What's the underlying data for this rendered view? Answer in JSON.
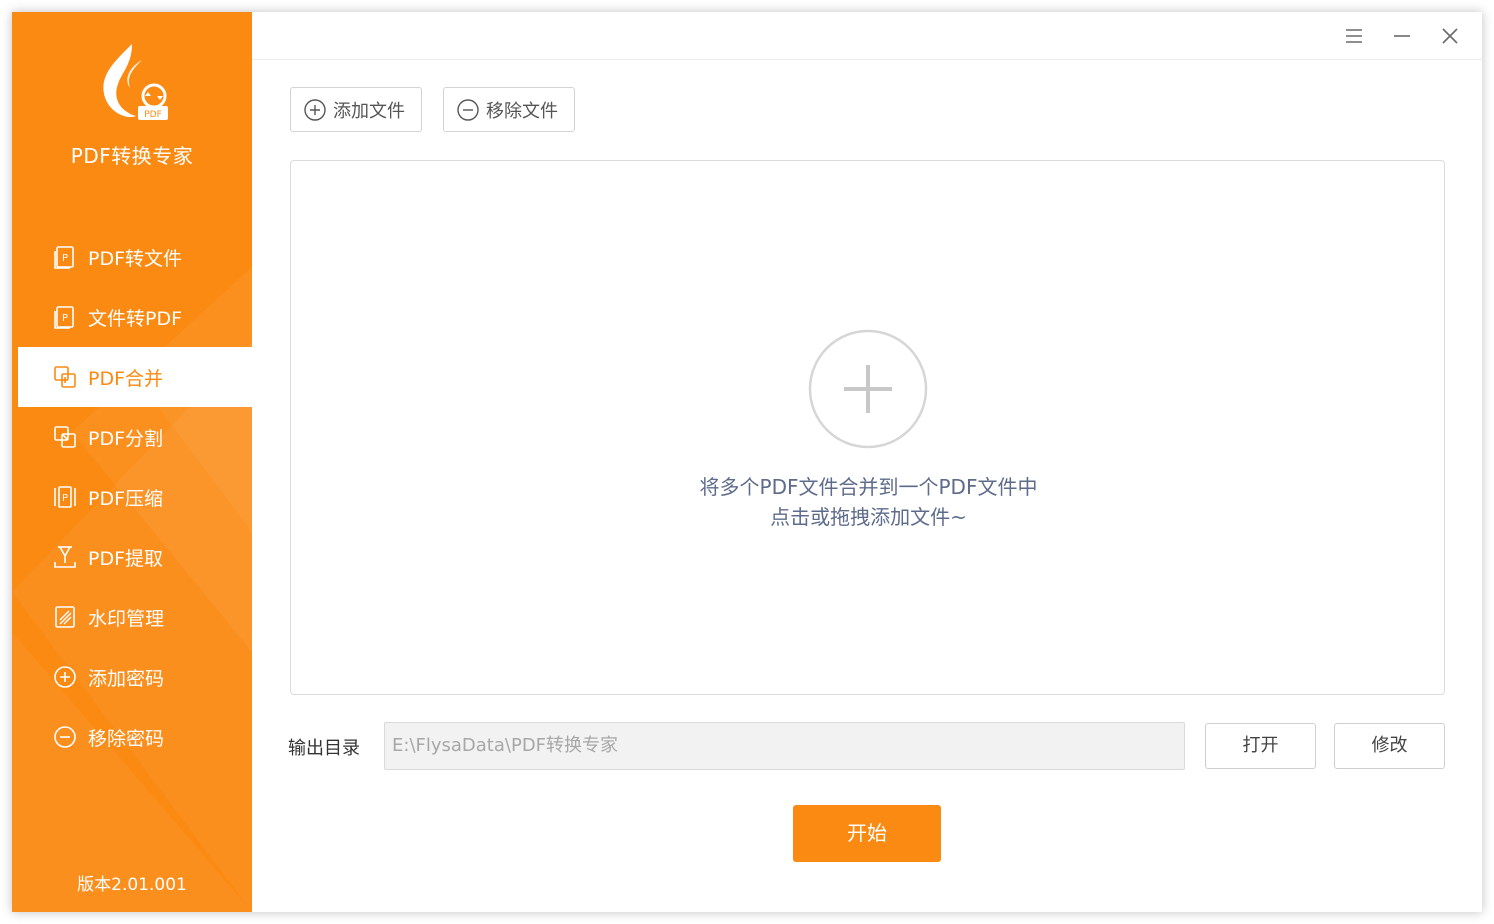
{
  "app": {
    "name": "PDF转换专家",
    "logo_badge": "PDF",
    "version": "版本2.01.001",
    "accent_color": "#fb8a12"
  },
  "titlebar": {
    "icons": [
      "menu-icon",
      "minimize-icon",
      "close-icon"
    ]
  },
  "sidebar": {
    "items": [
      {
        "label": "PDF转文件",
        "icon": "pdf-document-icon",
        "active": false
      },
      {
        "label": "文件转PDF",
        "icon": "pdf-document-icon",
        "active": false
      },
      {
        "label": "PDF合并",
        "icon": "merge-icon",
        "active": true
      },
      {
        "label": "PDF分割",
        "icon": "split-icon",
        "active": false
      },
      {
        "label": "PDF压缩",
        "icon": "compress-icon",
        "active": false
      },
      {
        "label": "PDF提取",
        "icon": "extract-icon",
        "active": false
      },
      {
        "label": "水印管理",
        "icon": "watermark-icon",
        "active": false
      },
      {
        "label": "添加密码",
        "icon": "plus-circle-icon",
        "active": false
      },
      {
        "label": "移除密码",
        "icon": "minus-circle-icon",
        "active": false
      }
    ]
  },
  "toolbar": {
    "add_label": "添加文件",
    "remove_label": "移除文件"
  },
  "dropzone": {
    "line1": "将多个PDF文件合并到一个PDF文件中",
    "line2": "点击或拖拽添加文件~"
  },
  "output": {
    "label": "输出目录",
    "path": "E:\\FlysaData\\PDF转换专家",
    "open_label": "打开",
    "modify_label": "修改"
  },
  "start_label": "开始"
}
